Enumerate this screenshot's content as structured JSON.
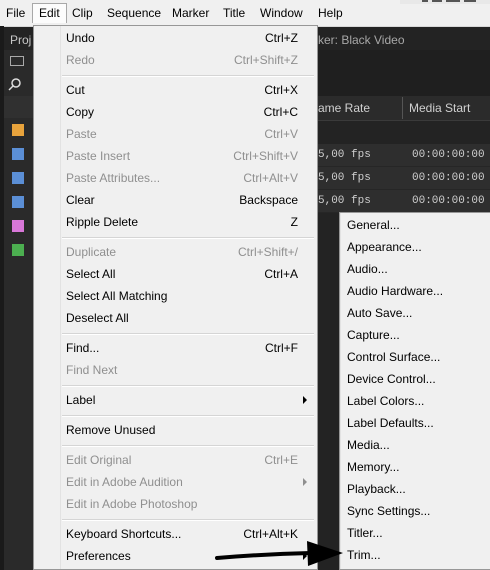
{
  "menubar": {
    "items": [
      {
        "label": "File"
      },
      {
        "label": "Edit"
      },
      {
        "label": "Clip"
      },
      {
        "label": "Sequence"
      },
      {
        "label": "Marker"
      },
      {
        "label": "Title"
      },
      {
        "label": "Window"
      },
      {
        "label": "Help"
      }
    ],
    "active": "Edit"
  },
  "background": {
    "project_tab": "Proj",
    "source_tab": "ker: Black Video",
    "columns": [
      "ame Rate",
      "Media Start"
    ],
    "rows": [
      {
        "rate": "5,00 fps",
        "start": "00:00:00:00"
      },
      {
        "rate": "5,00 fps",
        "start": "00:00:00:00"
      },
      {
        "rate": "5,00 fps",
        "start": "00:00:00:00"
      }
    ],
    "swatch_colors": [
      "#e8a33c",
      "#5b8fd6",
      "#5b8fd6",
      "#5b8fd6",
      "#d877d8",
      "#4caf50"
    ]
  },
  "edit_menu": {
    "items": [
      {
        "label": "Undo",
        "shortcut": "Ctrl+Z",
        "enabled": true
      },
      {
        "label": "Redo",
        "shortcut": "Ctrl+Shift+Z",
        "enabled": false
      },
      {
        "label": "Cut",
        "shortcut": "Ctrl+X",
        "enabled": true
      },
      {
        "label": "Copy",
        "shortcut": "Ctrl+C",
        "enabled": true
      },
      {
        "label": "Paste",
        "shortcut": "Ctrl+V",
        "enabled": false
      },
      {
        "label": "Paste Insert",
        "shortcut": "Ctrl+Shift+V",
        "enabled": false
      },
      {
        "label": "Paste Attributes...",
        "shortcut": "Ctrl+Alt+V",
        "enabled": false
      },
      {
        "label": "Clear",
        "shortcut": "Backspace",
        "enabled": true
      },
      {
        "label": "Ripple Delete",
        "shortcut": "Z",
        "enabled": true
      },
      {
        "label": "Duplicate",
        "shortcut": "Ctrl+Shift+/",
        "enabled": false
      },
      {
        "label": "Select All",
        "shortcut": "Ctrl+A",
        "enabled": true
      },
      {
        "label": "Select All Matching",
        "shortcut": "",
        "enabled": true
      },
      {
        "label": "Deselect All",
        "shortcut": "",
        "enabled": true
      },
      {
        "label": "Find...",
        "shortcut": "Ctrl+F",
        "enabled": true
      },
      {
        "label": "Find Next",
        "shortcut": "",
        "enabled": false
      },
      {
        "label": "Label",
        "shortcut": "",
        "enabled": true,
        "submenu": true
      },
      {
        "label": "Remove Unused",
        "shortcut": "",
        "enabled": true
      },
      {
        "label": "Edit Original",
        "shortcut": "Ctrl+E",
        "enabled": false
      },
      {
        "label": "Edit in Adobe Audition",
        "shortcut": "",
        "enabled": false,
        "submenu": true
      },
      {
        "label": "Edit in Adobe Photoshop",
        "shortcut": "",
        "enabled": false
      },
      {
        "label": "Keyboard Shortcuts...",
        "shortcut": "Ctrl+Alt+K",
        "enabled": true
      },
      {
        "label": "Preferences",
        "shortcut": "",
        "enabled": true,
        "submenu": true
      }
    ]
  },
  "preferences_submenu": {
    "items": [
      "General...",
      "Appearance...",
      "Audio...",
      "Audio Hardware...",
      "Auto Save...",
      "Capture...",
      "Control Surface...",
      "Device Control...",
      "Label Colors...",
      "Label Defaults...",
      "Media...",
      "Memory...",
      "Playback...",
      "Sync Settings...",
      "Titler...",
      "Trim..."
    ]
  }
}
